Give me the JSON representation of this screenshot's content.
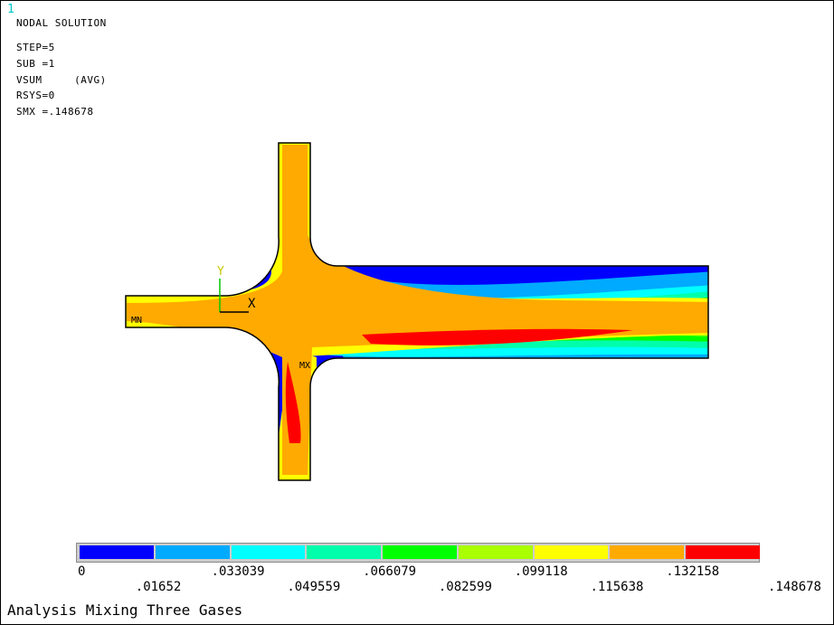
{
  "window_number": "1",
  "header": {
    "title": "NODAL SOLUTION",
    "step": "STEP=5",
    "sub": "SUB =1",
    "item": "VSUM     (AVG)",
    "rsys": "RSYS=0",
    "smx": "SMX =.148678"
  },
  "markers": {
    "min": "MN",
    "max": "MX",
    "axis_y": "Y",
    "axis_x": "X"
  },
  "colors": [
    "#0000ff",
    "#00aaff",
    "#00ffff",
    "#00ffaa",
    "#00ff00",
    "#aaff00",
    "#ffff00",
    "#ffaa00",
    "#ff0000"
  ],
  "legend_values": [
    "0",
    ".01652",
    ".033039",
    ".049559",
    ".066079",
    ".082599",
    ".099118",
    ".115638",
    ".132158",
    ".148678"
  ],
  "footer_title": "Analysis Mixing Three Gases"
}
